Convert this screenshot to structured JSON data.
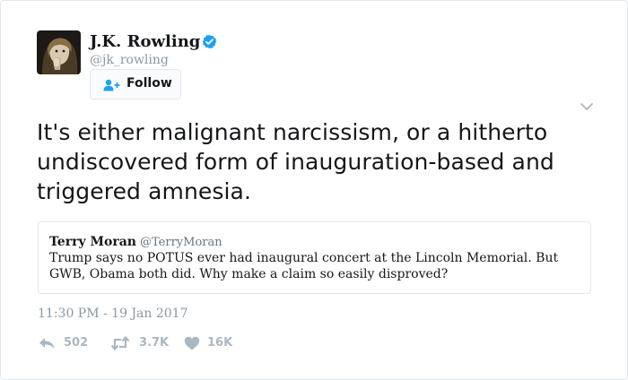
{
  "author": {
    "name": "J.K. Rowling",
    "handle": "@jk_rowling",
    "verified": true,
    "avatar_icon": "profile-photo"
  },
  "follow_button": {
    "label": "Follow",
    "icon": "add-user-icon"
  },
  "tweet": {
    "text": "It's either malignant narcissism, or a hitherto undiscovered form of inauguration-based and triggered amnesia.",
    "timestamp": "11:30 PM - 19 Jan 2017"
  },
  "quoted_tweet": {
    "name": "Terry Moran",
    "handle": "@TerryMoran",
    "text": "Trump says no POTUS ever had inaugural concert at the Lincoln Memorial. But GWB, Obama both did. Why make a claim so easily disproved?"
  },
  "actions": {
    "reply": {
      "count": "502",
      "icon": "reply-icon"
    },
    "retweet": {
      "count": "3.7K",
      "icon": "retweet-icon"
    },
    "like": {
      "count": "16K",
      "icon": "heart-icon"
    }
  },
  "colors": {
    "text": "#14171a",
    "secondary": "#8899a6",
    "verified_blue": "#1da1f2",
    "action_gray": "#aab8c2",
    "border": "#e1e8ed"
  }
}
